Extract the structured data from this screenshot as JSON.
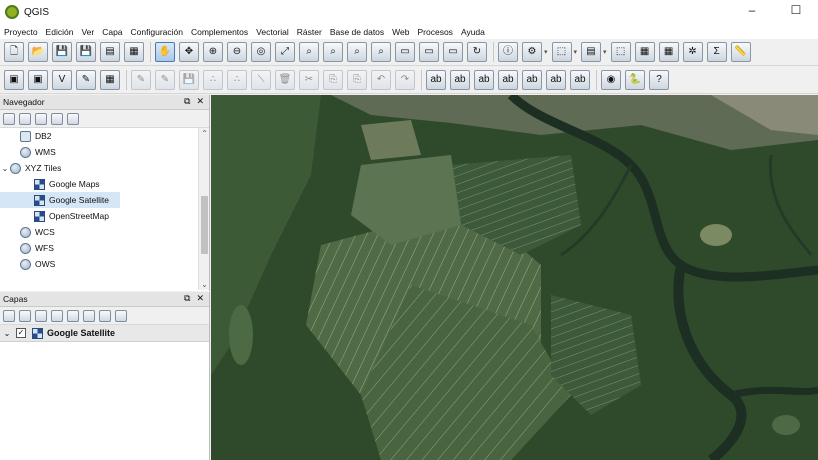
{
  "window": {
    "title": "QGIS"
  },
  "menu": [
    "Proyecto",
    "Edición",
    "Ver",
    "Capa",
    "Configuración",
    "Complementos",
    "Vectorial",
    "Ráster",
    "Base de datos",
    "Web",
    "Procesos",
    "Ayuda"
  ],
  "navigator": {
    "title": "Navegador",
    "items": [
      {
        "label": "DB2",
        "icon": "db2-icon",
        "indent": 1,
        "selected": false
      },
      {
        "label": "WMS",
        "icon": "globe-icon",
        "indent": 1,
        "selected": false
      },
      {
        "label": "XYZ Tiles",
        "icon": "globe-icon",
        "indent": 0,
        "expanded": true,
        "selected": false
      },
      {
        "label": "Google Maps",
        "icon": "tile-icon",
        "indent": 2,
        "selected": false
      },
      {
        "label": "Google Satellite",
        "icon": "tile-icon",
        "indent": 2,
        "selected": true
      },
      {
        "label": "OpenStreetMap",
        "icon": "tile-icon",
        "indent": 2,
        "selected": false
      },
      {
        "label": "WCS",
        "icon": "globe-icon",
        "indent": 1,
        "selected": false
      },
      {
        "label": "WFS",
        "icon": "globe-icon",
        "indent": 1,
        "selected": false
      },
      {
        "label": "OWS",
        "icon": "globe-icon",
        "indent": 1,
        "selected": false
      }
    ]
  },
  "layers": {
    "title": "Capas",
    "items": [
      {
        "label": "Google Satellite",
        "checked": true,
        "expanded": true
      }
    ]
  },
  "colors": {
    "accent": "#93b023",
    "selection": "#d5e6f7"
  }
}
